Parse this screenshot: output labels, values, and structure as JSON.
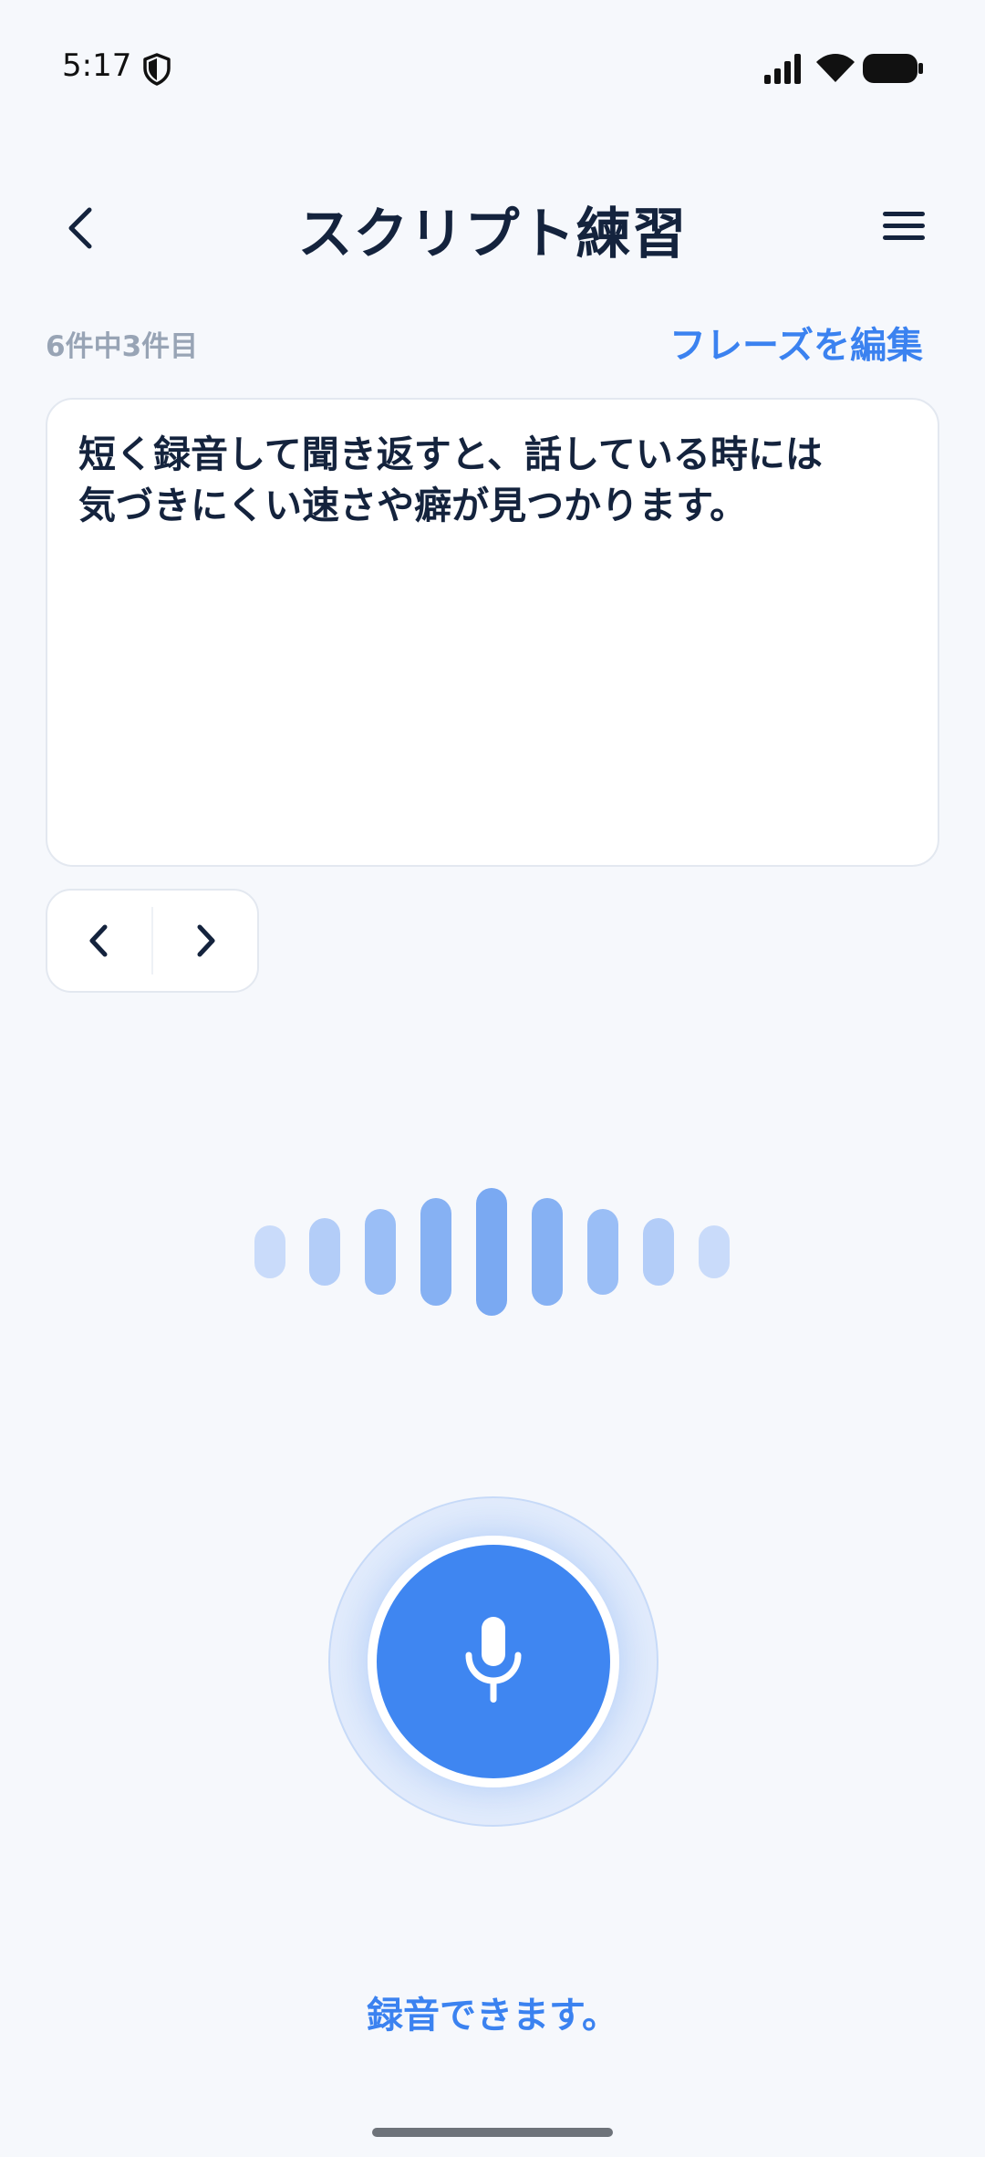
{
  "status_bar": {
    "time": "5:17"
  },
  "header": {
    "title": "スクリプト練習",
    "back_icon": "chevron-left-icon",
    "menu_icon": "hamburger-menu-icon"
  },
  "phrase": {
    "counter": "6件中3件目",
    "edit_label": "フレーズを編集",
    "line1": "短く録音して聞き返すと、話している時には",
    "line2": "気づきにくい速さや癖が見つかります。"
  },
  "navigation": {
    "prev_icon": "chevron-left-icon",
    "next_icon": "chevron-right-icon"
  },
  "recorder": {
    "mic_icon": "microphone-icon",
    "status": "録音できます。"
  },
  "colors": {
    "accent": "#3B82F0",
    "background": "#F6F8FC",
    "text_primary": "#14233D",
    "text_muted": "#98A4B5"
  }
}
